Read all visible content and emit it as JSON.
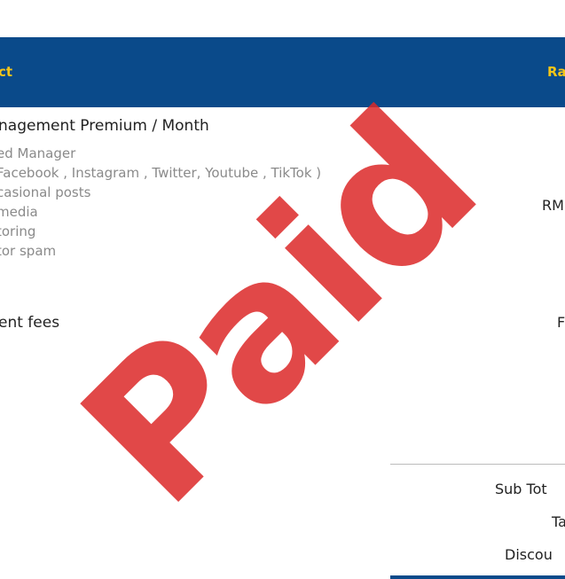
{
  "table": {
    "headers": {
      "product": "ct",
      "rate": "Ra"
    },
    "colors": {
      "header_bg": "#0a4a8a",
      "header_text": "#f5c518",
      "watermark": "#dc2828"
    },
    "items": [
      {
        "title": "nagement Premium / Month",
        "features": [
          "ed Manager",
          " Facebook , Instagram , Twitter, Youtube , TikTok )",
          "casional posts",
          "media",
          "toring",
          "tor spam"
        ],
        "rate": "RM"
      },
      {
        "title": "ent fees",
        "rate": "F"
      }
    ]
  },
  "totals": {
    "subtotal_label": "Sub Tot",
    "tax_label": "Ta",
    "discount_label": "Discou"
  },
  "watermark": {
    "text": "Paid"
  }
}
